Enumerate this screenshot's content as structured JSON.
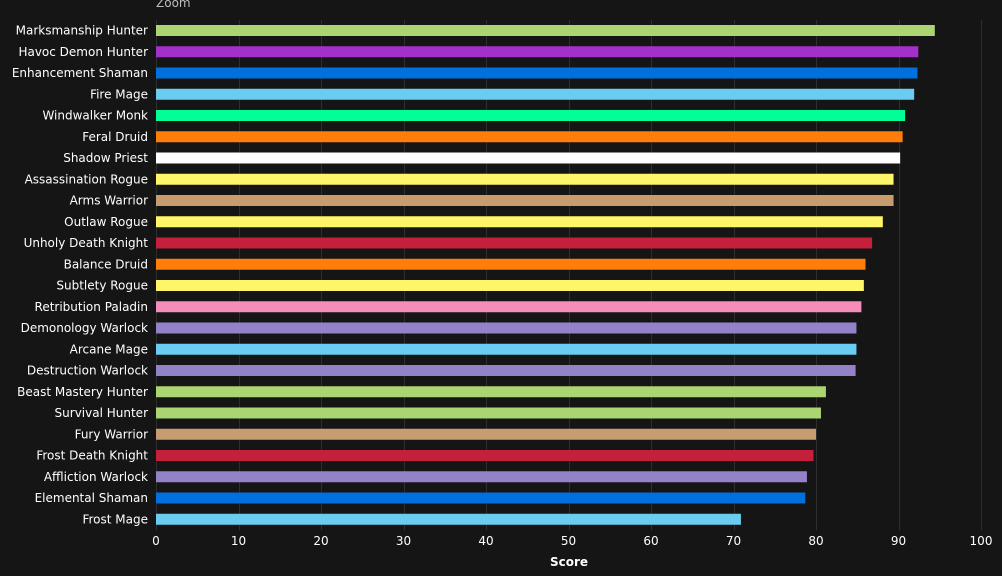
{
  "toolbar": {
    "zoom_label": "Zoom"
  },
  "chart_data": {
    "type": "bar",
    "orientation": "horizontal",
    "title": "",
    "xlabel": "Score",
    "ylabel": "",
    "xlim": [
      0,
      100
    ],
    "xticks": [
      0,
      10,
      20,
      30,
      40,
      50,
      60,
      70,
      80,
      90,
      100
    ],
    "grid": true,
    "legend": "none",
    "categories": [
      "Marksmanship Hunter",
      "Havoc Demon Hunter",
      "Enhancement Shaman",
      "Fire Mage",
      "Windwalker Monk",
      "Feral Druid",
      "Shadow Priest",
      "Assassination Rogue",
      "Arms Warrior",
      "Outlaw Rogue",
      "Unholy Death Knight",
      "Balance Druid",
      "Subtlety Rogue",
      "Retribution Paladin",
      "Demonology Warlock",
      "Arcane Mage",
      "Destruction Warlock",
      "Beast Mastery Hunter",
      "Survival Hunter",
      "Fury Warrior",
      "Frost Death Knight",
      "Affliction Warlock",
      "Elemental Shaman",
      "Frost Mage"
    ],
    "values": [
      94.4,
      92.4,
      92.3,
      91.9,
      90.8,
      90.5,
      90.2,
      89.4,
      89.4,
      88.1,
      86.8,
      86.0,
      85.8,
      85.5,
      84.9,
      84.9,
      84.8,
      81.2,
      80.6,
      80.0,
      79.7,
      78.9,
      78.7,
      70.9
    ],
    "colors": [
      "#abd473",
      "#a330c9",
      "#0070de",
      "#69ccf0",
      "#00ff96",
      "#ff7d0a",
      "#ffffff",
      "#fff569",
      "#c79c6e",
      "#fff569",
      "#c41f3b",
      "#ff7d0a",
      "#fff569",
      "#f58cba",
      "#9482c9",
      "#69ccf0",
      "#9482c9",
      "#abd473",
      "#abd473",
      "#c79c6e",
      "#c41f3b",
      "#9482c9",
      "#0070de",
      "#69ccf0"
    ],
    "style": {
      "background": "#151515",
      "grid_color": "#2e2e2e",
      "label_color": "#ffffff"
    }
  }
}
